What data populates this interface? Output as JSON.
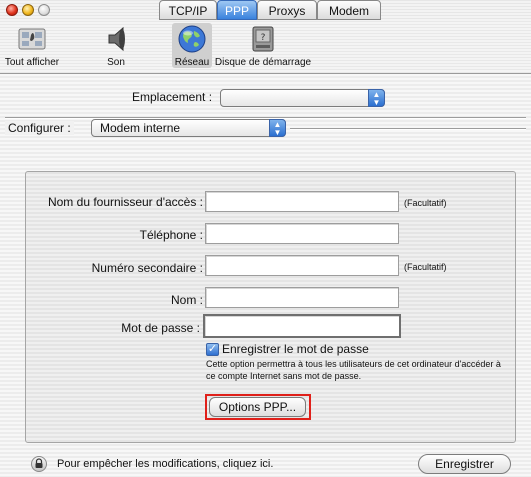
{
  "window": {
    "title": "Réseau"
  },
  "toolbar": {
    "items": [
      {
        "label": "Tout afficher",
        "icon": "show-all-icon"
      },
      {
        "label": "Son",
        "icon": "speaker-icon"
      },
      {
        "label": "Réseau",
        "icon": "globe-icon",
        "selected": true
      },
      {
        "label": "Disque de démarrage",
        "icon": "startup-disk-icon"
      }
    ]
  },
  "location": {
    "label": "Emplacement :",
    "value": ""
  },
  "configure": {
    "label": "Configurer :",
    "value": "Modem interne"
  },
  "tabs": [
    {
      "label": "TCP/IP"
    },
    {
      "label": "PPP",
      "active": true
    },
    {
      "label": "Proxys"
    },
    {
      "label": "Modem"
    }
  ],
  "form": {
    "provider": {
      "label": "Nom du fournisseur d'accès :",
      "value": "",
      "hint": "(Facultatif)"
    },
    "phone": {
      "label": "Téléphone :",
      "value": ""
    },
    "alt_phone": {
      "label": "Numéro secondaire :",
      "value": "",
      "hint": "(Facultatif)"
    },
    "name": {
      "label": "Nom :",
      "value": ""
    },
    "password": {
      "label": "Mot de passe :",
      "value": ""
    },
    "save_password": {
      "label": "Enregistrer le mot de passe",
      "checked": true,
      "description": "Cette option permettra à tous les utilisateurs de cet ordinateur d'accéder à ce compte Internet sans mot de passe."
    },
    "ppp_options_button": "Options PPP..."
  },
  "footer": {
    "lock_text": "Pour empêcher les modifications, cliquez ici.",
    "save_button": "Enregistrer"
  },
  "colors": {
    "highlight": "#e0201a",
    "accent": "#3a82dd"
  }
}
